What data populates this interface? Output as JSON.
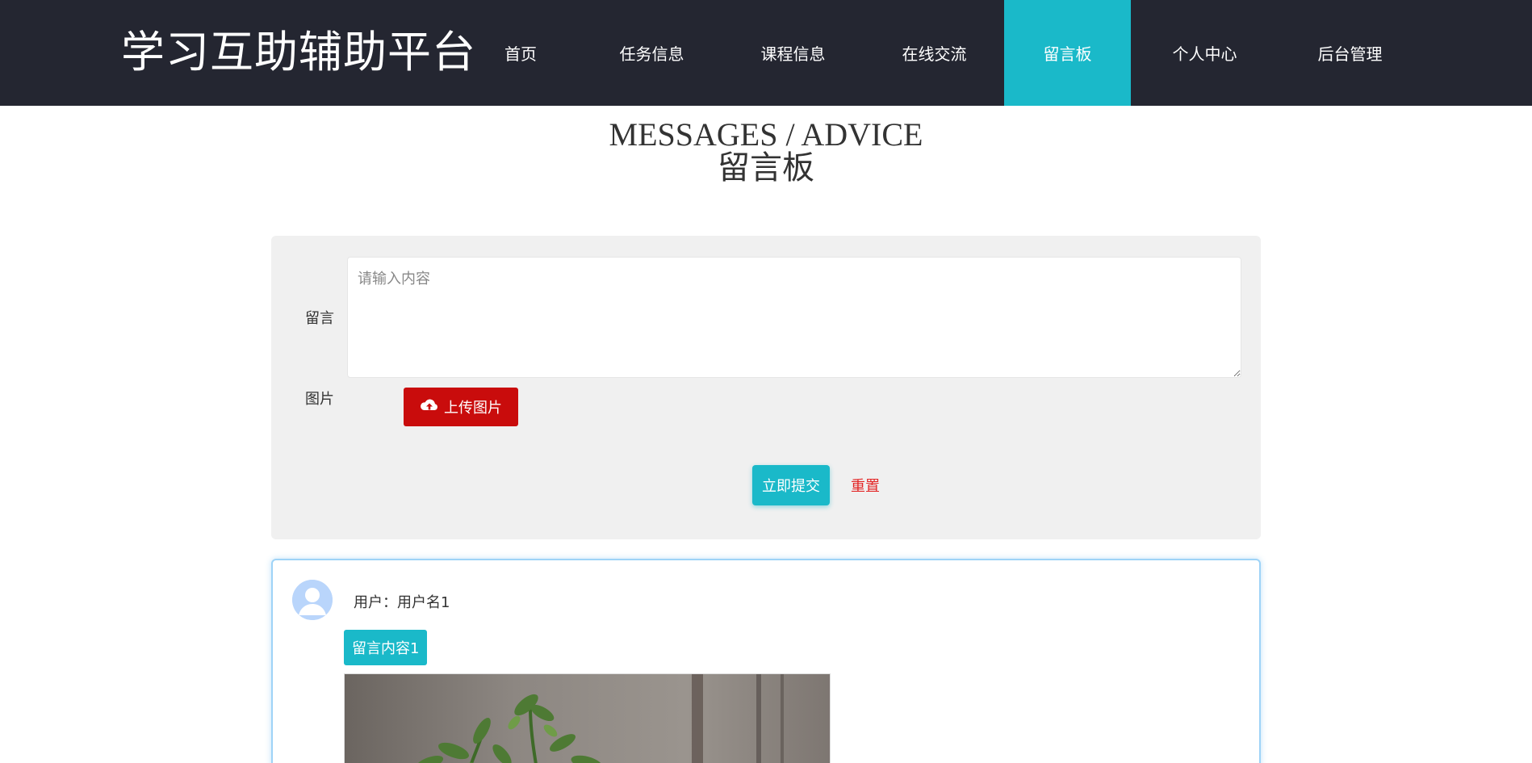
{
  "header": {
    "brand": "学习互助辅助平台",
    "nav": [
      {
        "label": "首页"
      },
      {
        "label": "任务信息"
      },
      {
        "label": "课程信息"
      },
      {
        "label": "在线交流"
      },
      {
        "label": "留言板",
        "active": true
      },
      {
        "label": "个人中心"
      },
      {
        "label": "后台管理"
      }
    ],
    "bg_color": "#242631",
    "active_color": "#1ab9c9"
  },
  "page": {
    "title_en": "MESSAGES / ADVICE",
    "title_zh": "留言板"
  },
  "form": {
    "message_label": "留言",
    "message_placeholder": "请输入内容",
    "message_value": "",
    "image_label": "图片",
    "upload_label": "上传图片",
    "upload_icon": "cloud-upload-icon",
    "submit_label": "立即提交",
    "reset_label": "重置",
    "upload_color": "#c90c0c",
    "reset_color": "#e32626"
  },
  "comments": [
    {
      "user_prefix": "用户：",
      "user_name": "用户名1",
      "content": "留言内容1",
      "avatar_icon": "user-avatar-icon",
      "image": "plant-photo"
    }
  ]
}
